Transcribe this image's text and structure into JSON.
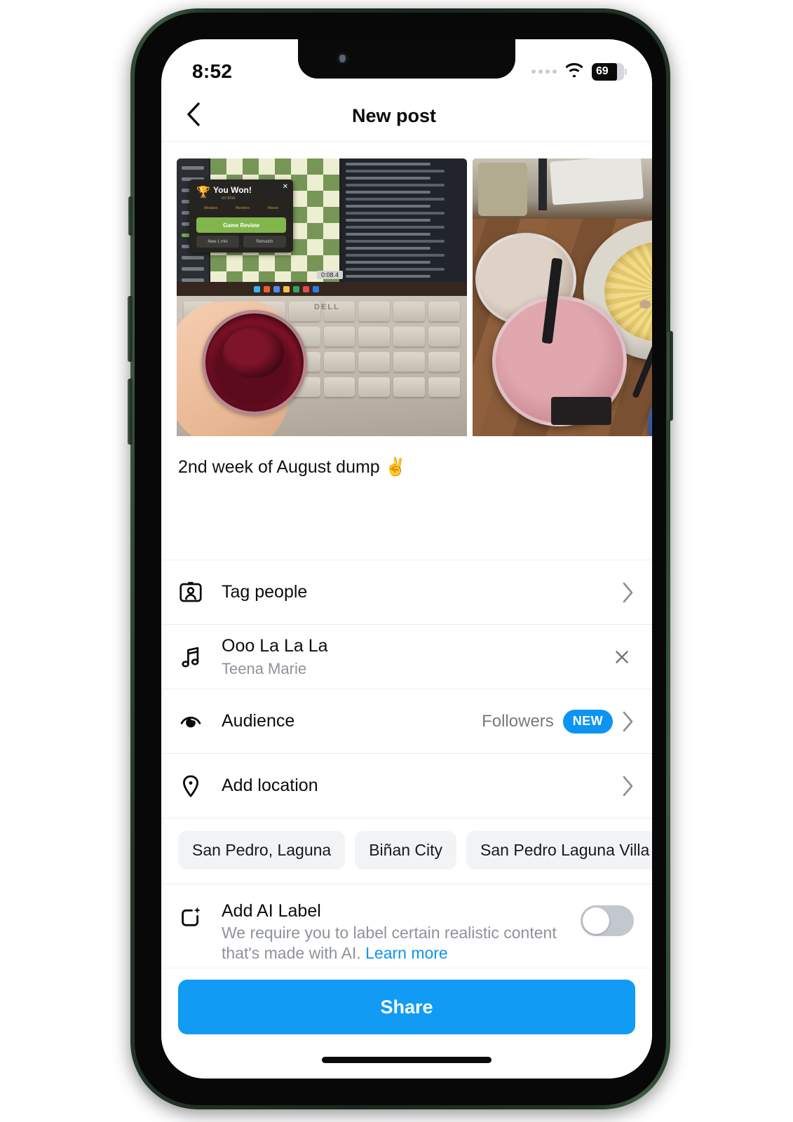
{
  "status_bar": {
    "time": "8:52",
    "wifi_icon": "wifi-icon",
    "signal_icon": "signal-dots-icon",
    "battery_level": "69",
    "battery_icon": "battery-icon"
  },
  "nav": {
    "back_icon": "chevron-left-icon",
    "title": "New post"
  },
  "media": {
    "thumbnails": [
      {
        "name": "photo-chess-cheesecake",
        "alt": "Hand holding a blueberry cheesecake cup in front of a Dell laptop showing a chess.com You Won screen",
        "overlay": {
          "dialog_title": "You Won!",
          "dialog_subtitle": "on time",
          "primary_button": "Game Review",
          "secondary_button_left": "New 1 min",
          "secondary_button_right": "Rematch",
          "stat_labels": [
            "Mistakes",
            "Blunders",
            "Misses"
          ],
          "timer": "0:08.4",
          "brand": "DELL"
        }
      },
      {
        "name": "photo-pasta-smoothie",
        "alt": "Carbonara pasta in a speckled bowl with two pink smoothie cups on a wooden table"
      }
    ]
  },
  "caption": {
    "text": "2nd week of August dump ✌️"
  },
  "rows": {
    "tag_people": {
      "icon": "tag-people-icon",
      "label": "Tag people",
      "chevron": "chevron-right-icon"
    },
    "music": {
      "icon": "music-note-icon",
      "title": "Ooo La La La",
      "artist": "Teena Marie",
      "remove_icon": "close-icon"
    },
    "audience": {
      "icon": "audience-icon",
      "label": "Audience",
      "value": "Followers",
      "badge": "NEW",
      "chevron": "chevron-right-icon"
    },
    "location": {
      "icon": "location-pin-icon",
      "label": "Add location",
      "chevron": "chevron-right-icon"
    }
  },
  "location_suggestions": [
    "San Pedro, Laguna",
    "Biñan City",
    "San Pedro Laguna Villa"
  ],
  "ai_label": {
    "icon": "ai-sparkle-icon",
    "title": "Add AI Label",
    "subtitle": "We require you to label certain realistic",
    "subtitle_line2": "content that's made with AI.",
    "subtitle_link": "Learn more",
    "toggle_state": "off"
  },
  "share": {
    "label": "Share"
  },
  "colors": {
    "accent_blue": "#119bf5",
    "badge_blue": "#0d94f2",
    "muted_text": "#8e9399",
    "chip_bg": "#f2f3f5",
    "frame_green": "#2d4333"
  }
}
